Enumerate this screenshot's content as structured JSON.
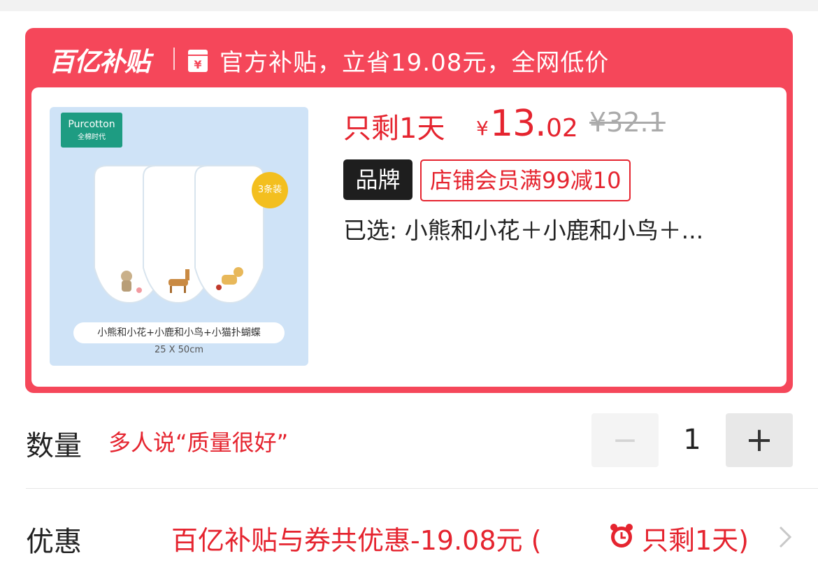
{
  "subsidy": {
    "brand_logo": "百亿补贴",
    "header_text": "官方补贴，立省19.08元，全网低价"
  },
  "product": {
    "image": {
      "logo_name": "Purcotton",
      "logo_sub": "全棉时代",
      "pack_badge": "3条装",
      "variant_caption": "小熊和小花+小鹿和小鸟+小猫扑蝴蝶",
      "size_caption": "25 X 50cm"
    },
    "countdown": "只剩1天",
    "currency": "¥",
    "price_main": "13.",
    "price_decimals": "02",
    "original_price": "¥32.1",
    "brand_tag": "品牌",
    "promo_tag": "店铺会员满99减10",
    "selected": "已选: 小熊和小花＋小鹿和小鸟＋..."
  },
  "quantity": {
    "label": "数量",
    "hint": "多人说“质量很好”",
    "minus": "−",
    "value": "1",
    "plus": "+"
  },
  "discount": {
    "label": "优惠",
    "text": "百亿补贴与券共优惠-19.08元 (",
    "remain": "只剩1天)"
  },
  "colors": {
    "accent_red": "#e5242f",
    "card_red": "#f5475a"
  },
  "icons": [
    "ticket-icon",
    "clock-icon",
    "chevron-right-icon"
  ]
}
